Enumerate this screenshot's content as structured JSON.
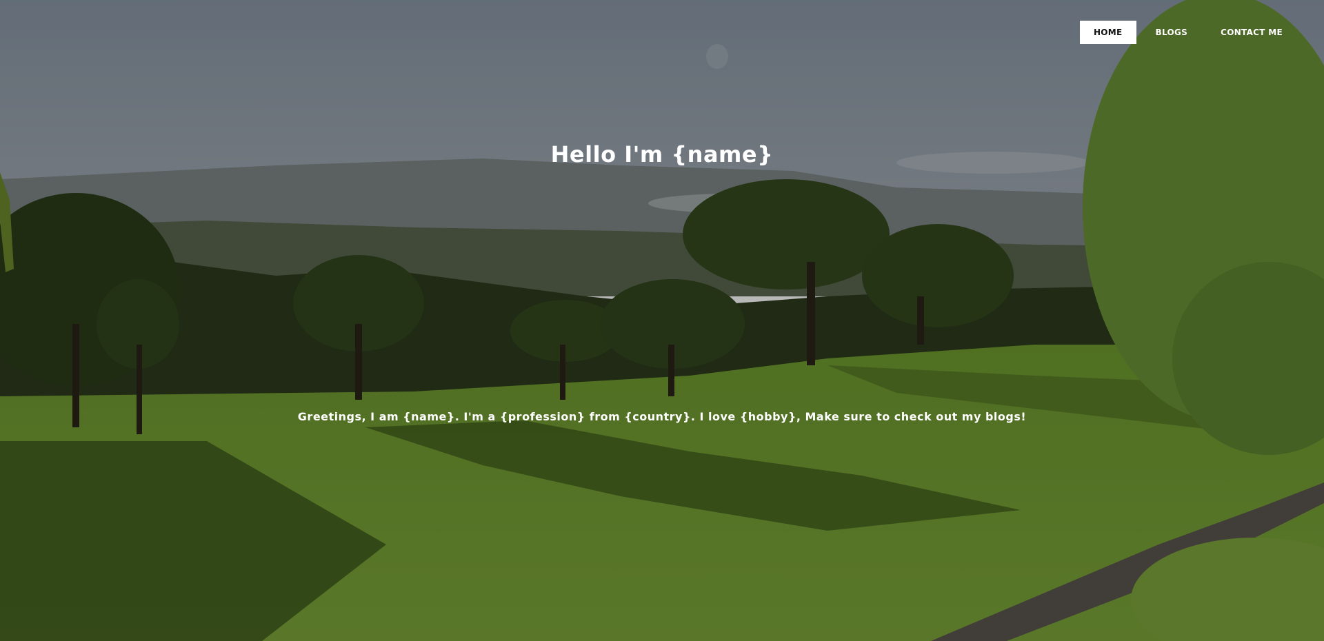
{
  "nav": {
    "items": [
      {
        "label": "HOME",
        "active": true
      },
      {
        "label": "BLOGS",
        "active": false
      },
      {
        "label": "CONTACT ME",
        "active": false
      }
    ]
  },
  "hero": {
    "title": "Hello I'm {name}",
    "subtitle": "Greetings, I am {name}. I'm a {profession} from {country}. I love {hobby}, Make sure to check out my blogs!",
    "background_image": "golf-course-landscape-photo"
  },
  "colors": {
    "nav_active_bg": "#ffffff",
    "nav_active_text": "#111111",
    "text": "#ffffff"
  }
}
